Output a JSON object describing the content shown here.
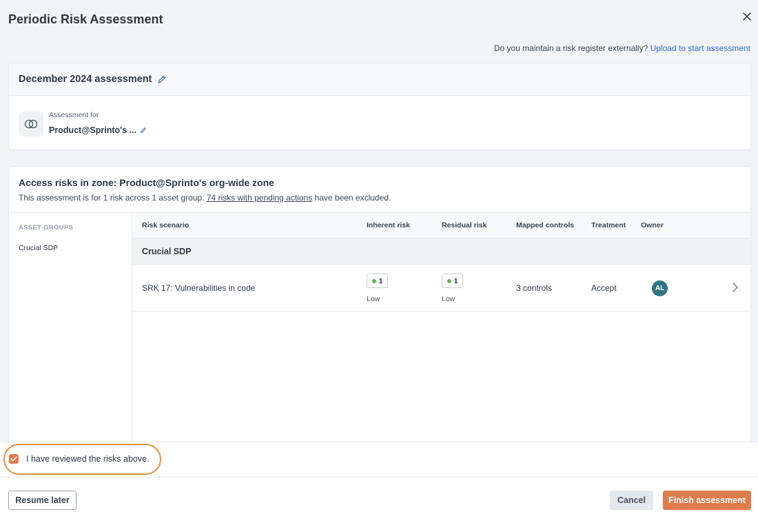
{
  "modal": {
    "title": "Periodic Risk Assessment"
  },
  "upload": {
    "prompt": "Do you maintain a risk register externally?",
    "link": "Upload to start assessment"
  },
  "assessment": {
    "name": "December 2024 assessment",
    "for_label": "Assessment for",
    "for_value": "Product@Sprinto's ..."
  },
  "zone": {
    "title": "Access risks in zone: Product@Sprinto's org-wide zone",
    "sub_prefix": "This assessment is for 1 risk across 1 asset group.",
    "sub_link": "74 risks with pending actions",
    "sub_suffix": " have been excluded."
  },
  "sidebar": {
    "header": "ASSET GROUPS",
    "items": [
      {
        "label": "Crucial SDP"
      }
    ]
  },
  "table": {
    "columns": [
      "Risk scenario",
      "Inherent risk",
      "Residual risk",
      "Mapped controls",
      "Treatment",
      "Owner"
    ],
    "group": "Crucial SDP",
    "rows": [
      {
        "scenario": "SRK 17: Vulnerabilities in code",
        "inherent_value": "1",
        "inherent_label": "Low",
        "residual_value": "1",
        "residual_label": "Low",
        "controls": "3 controls",
        "treatment": "Accept",
        "owner_initials": "AL"
      }
    ]
  },
  "review": {
    "label": "I have reviewed the risks above.",
    "checked": true
  },
  "buttons": {
    "resume": "Resume later",
    "cancel": "Cancel",
    "finish": "Finish assessment"
  },
  "colors": {
    "accent": "#e07b4c",
    "link": "#2f6fd6",
    "highlight": "#e8913b",
    "risk_low": "#6ab04c",
    "avatar": "#2f7381"
  }
}
